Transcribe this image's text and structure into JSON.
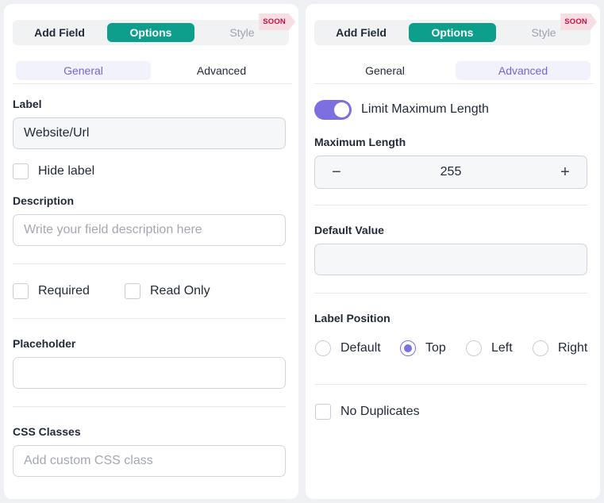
{
  "left_panel": {
    "tabs": {
      "add_field": "Add Field",
      "options": "Options",
      "style": "Style",
      "soon_badge": "SOON"
    },
    "sub_tabs": {
      "general": "General",
      "advanced": "Advanced",
      "active": "general"
    },
    "label_field": {
      "label": "Label",
      "value": "Website/Url"
    },
    "hide_label": {
      "label": "Hide label",
      "checked": false
    },
    "description": {
      "label": "Description",
      "placeholder": "Write your field description here"
    },
    "required": {
      "label": "Required",
      "checked": false
    },
    "read_only": {
      "label": "Read Only",
      "checked": false
    },
    "placeholder_field": {
      "label": "Placeholder",
      "value": ""
    },
    "css_classes": {
      "label": "CSS Classes",
      "placeholder": "Add custom CSS class"
    }
  },
  "right_panel": {
    "tabs": {
      "add_field": "Add Field",
      "options": "Options",
      "style": "Style",
      "soon_badge": "SOON"
    },
    "sub_tabs": {
      "general": "General",
      "advanced": "Advanced",
      "active": "advanced"
    },
    "limit_max_length": {
      "label": "Limit Maximum Length",
      "enabled": true
    },
    "maximum_length": {
      "label": "Maximum Length",
      "value": "255",
      "minus": "−",
      "plus": "+"
    },
    "default_value": {
      "label": "Default Value",
      "value": ""
    },
    "label_position": {
      "label": "Label Position",
      "options": [
        "Default",
        "Top",
        "Left",
        "Right"
      ],
      "selected": "Top"
    },
    "no_duplicates": {
      "label": "No Duplicates",
      "checked": false
    }
  },
  "colors": {
    "accent_teal": "#0d9e8c",
    "accent_purple": "#7c6fe0",
    "badge_bg": "#f8dde4",
    "badge_text": "#be123c"
  }
}
